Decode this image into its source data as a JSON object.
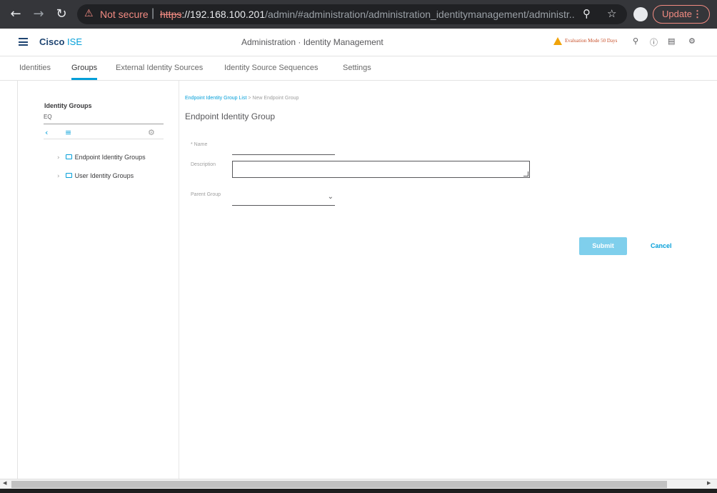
{
  "browser": {
    "security_warning": "Not secure",
    "url_protocol": "https",
    "url_host": "://192.168.100.201",
    "url_path": "/admin/#administration/administration_identitymanagement/administr...",
    "update_label": "Update"
  },
  "header": {
    "brand_bold": "Cisco",
    "brand_rest": "ISE",
    "title": "Administration · Identity Management",
    "eval_notice": "Evaluation Mode 50 Days"
  },
  "tabs": [
    {
      "label": "Identities",
      "active": false
    },
    {
      "label": "Groups",
      "active": true
    },
    {
      "label": "External Identity Sources",
      "active": false
    },
    {
      "label": "Identity Source Sequences",
      "active": false
    },
    {
      "label": "Settings",
      "active": false
    }
  ],
  "sidebar": {
    "title": "Identity Groups",
    "search_value": "EQ",
    "tree": [
      {
        "label": "Endpoint Identity Groups"
      },
      {
        "label": "User Identity Groups"
      }
    ]
  },
  "form": {
    "breadcrumb_link": "Endpoint Identity Group List",
    "breadcrumb_sep": ">",
    "breadcrumb_current": "New Endpoint Group",
    "title": "Endpoint Identity Group",
    "name_label": "* Name",
    "name_value": "",
    "description_label": "Description",
    "description_value": "",
    "parent_group_label": "Parent Group",
    "parent_group_value": "",
    "submit_label": "Submit",
    "cancel_label": "Cancel"
  },
  "colors": {
    "accent": "#049fd9",
    "brand_dark": "#1e4471",
    "submit_disabled": "#7fcfec",
    "warning": "#f0a30a"
  }
}
